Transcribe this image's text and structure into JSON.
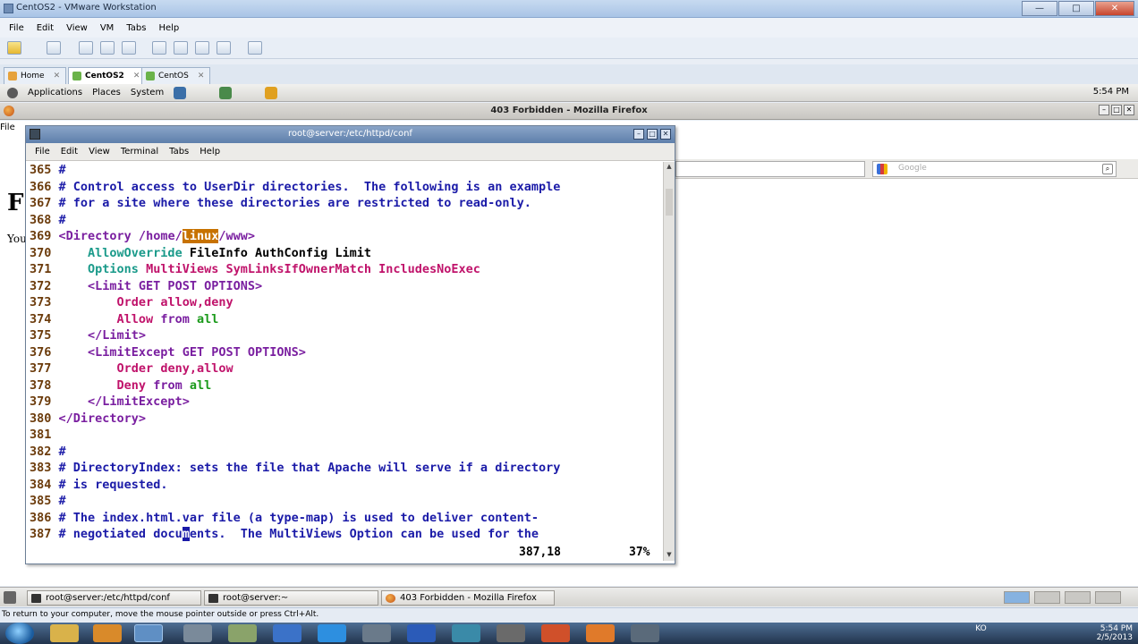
{
  "vmware": {
    "title": "CentOS2 - VMware Workstation",
    "menu": [
      "File",
      "Edit",
      "View",
      "VM",
      "Tabs",
      "Help"
    ],
    "tabs": [
      {
        "label": "Home",
        "active": false
      },
      {
        "label": "CentOS2",
        "active": true
      },
      {
        "label": "CentOS",
        "active": false
      }
    ],
    "status_message": "To return to your computer, move the mouse pointer outside or press Ctrl+Alt."
  },
  "gnome": {
    "panel_menus": [
      "Applications",
      "Places",
      "System"
    ],
    "clock": "5:54 PM"
  },
  "firefox": {
    "title": "403 Forbidden - Mozilla Firefox",
    "menu_first": "File",
    "search_placeholder": "Google",
    "page_heading_fragment": "F",
    "page_text_fragment": "You"
  },
  "terminal": {
    "title": "root@server:/etc/httpd/conf",
    "menu": [
      "File",
      "Edit",
      "View",
      "Terminal",
      "Tabs",
      "Help"
    ],
    "status_position": "387,18",
    "status_percent": "37%",
    "lines": [
      {
        "n": "365",
        "text": "#"
      },
      {
        "n": "366",
        "text": "# Control access to UserDir directories.  The following is an example"
      },
      {
        "n": "367",
        "text": "# for a site where these directories are restricted to read-only."
      },
      {
        "n": "368",
        "text": "#"
      },
      {
        "n": "369",
        "pre": "<Directory /home/",
        "highlight": "linux",
        "post": "/www>"
      },
      {
        "n": "370",
        "kw": "AllowOverride",
        "rest": " FileInfo AuthConfig Limit"
      },
      {
        "n": "371",
        "kw": "Options",
        "rest": " MultiViews SymLinksIfOwnerMatch IncludesNoExec"
      },
      {
        "n": "372",
        "text": "<Limit GET POST OPTIONS>"
      },
      {
        "n": "373",
        "kw": "Order",
        "rest": " allow,deny"
      },
      {
        "n": "374",
        "kw": "Allow",
        "mid": " from",
        "rest": " all"
      },
      {
        "n": "375",
        "text": "</Limit>"
      },
      {
        "n": "376",
        "text": "<LimitExcept GET POST OPTIONS>"
      },
      {
        "n": "377",
        "kw": "Order",
        "rest": " deny,allow"
      },
      {
        "n": "378",
        "kw": "Deny",
        "mid": " from",
        "rest": " all"
      },
      {
        "n": "379",
        "text": "</LimitExcept>"
      },
      {
        "n": "380",
        "text": "</Directory>"
      },
      {
        "n": "381",
        "text": ""
      },
      {
        "n": "382",
        "text": "#"
      },
      {
        "n": "383",
        "text": "# DirectoryIndex: sets the file that Apache will serve if a directory"
      },
      {
        "n": "384",
        "text": "# is requested."
      },
      {
        "n": "385",
        "text": "#"
      },
      {
        "n": "386",
        "text": "# The index.html.var file (a type-map) is used to deliver content-"
      },
      {
        "n": "387",
        "pre": "# negotiated docu",
        "cursor": "m",
        "post": "ents.  The MultiViews Option can be used for the"
      }
    ]
  },
  "gnome_taskbar": {
    "tasks": [
      "root@server:/etc/httpd/conf",
      "root@server:~",
      "403 Forbidden - Mozilla Firefox"
    ]
  },
  "windows": {
    "tray_lang": "KO",
    "tray_clock": "5:54 PM",
    "tray_date": "2/5/2013"
  }
}
